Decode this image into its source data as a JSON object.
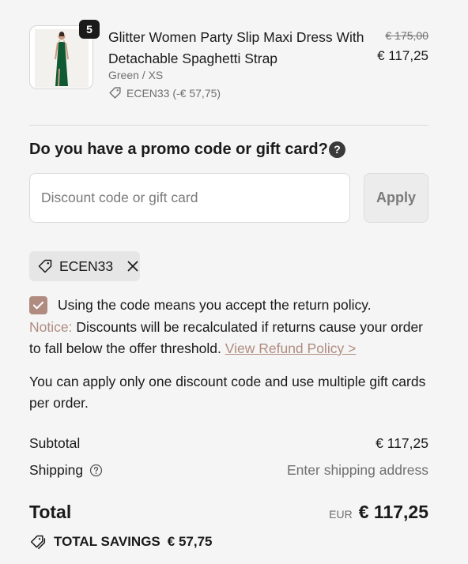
{
  "cart_item": {
    "quantity": "5",
    "title": "Glitter Women Party Slip Maxi Dress With Detachable Spaghetti Strap",
    "variant": "Green / XS",
    "discount_tag": "ECEN33 (-€ 57,75)",
    "original_price": "€ 175,00",
    "price": "€ 117,25"
  },
  "promo": {
    "heading": "Do you have a promo code or gift card?",
    "help_icon": "?",
    "input_placeholder": "Discount code or gift card",
    "input_value": "",
    "apply_label": "Apply",
    "applied_code": "ECEN33"
  },
  "policy": {
    "checked": true,
    "accept_text": "Using the code means you accept the return policy.",
    "notice_label": "Notice:",
    "notice_text": " Discounts will be recalculated if returns cause your order to fall below the offer threshold. ",
    "link_text": "View Refund Policy >"
  },
  "info_text": "You can apply only one discount code and use multiple gift cards per order.",
  "summary": {
    "subtotal_label": "Subtotal",
    "subtotal_value": "€ 117,25",
    "shipping_label": "Shipping",
    "shipping_value": "Enter shipping address",
    "total_label": "Total",
    "currency": "EUR",
    "total_value": "€ 117,25",
    "savings_label": "TOTAL SAVINGS",
    "savings_value": "€ 57,75"
  },
  "colors": {
    "accent": "#b08c80",
    "dress": "#0f5a32"
  },
  "icons": [
    "tag-icon",
    "help-icon",
    "close-icon",
    "checkmark-icon",
    "question-circle-icon",
    "double-tag-icon"
  ]
}
